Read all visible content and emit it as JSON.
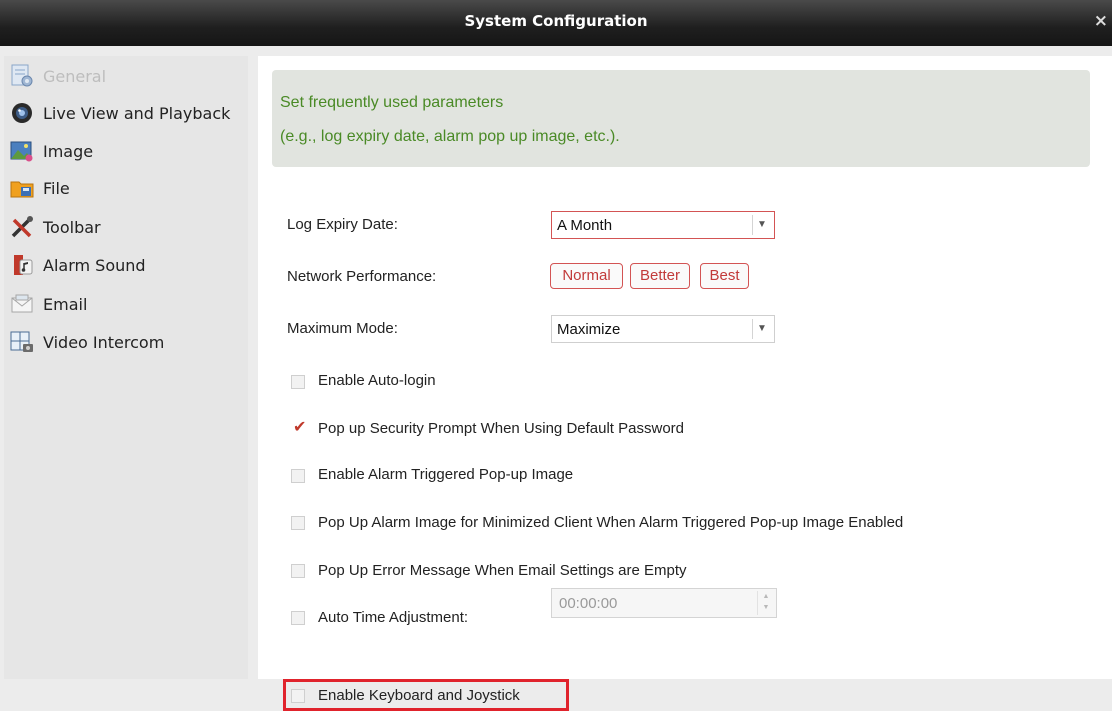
{
  "window": {
    "title": "System Configuration",
    "close_symbol": "×"
  },
  "sidebar": {
    "items": [
      {
        "label": "General",
        "icon": "general-settings-icon",
        "active": true
      },
      {
        "label": "Live View and Playback",
        "icon": "camera-lens-icon"
      },
      {
        "label": "Image",
        "icon": "image-icon"
      },
      {
        "label": "File",
        "icon": "file-folder-icon"
      },
      {
        "label": "Toolbar",
        "icon": "tools-icon"
      },
      {
        "label": "Alarm Sound",
        "icon": "alarm-sound-icon"
      },
      {
        "label": "Email",
        "icon": "email-icon"
      },
      {
        "label": "Video Intercom",
        "icon": "video-intercom-icon"
      }
    ]
  },
  "banner": {
    "line1": "Set frequently used parameters",
    "line2": "(e.g., log expiry date, alarm pop up image, etc.)."
  },
  "settings": {
    "log_expiry": {
      "label": "Log Expiry Date:",
      "value": "A Month"
    },
    "network_performance": {
      "label": "Network Performance:",
      "options": [
        "Normal",
        "Better",
        "Best"
      ]
    },
    "maximum_mode": {
      "label": "Maximum Mode:",
      "value": "Maximize"
    },
    "checkboxes": [
      {
        "label": "Enable Auto-login",
        "checked": false
      },
      {
        "label": "Pop up Security Prompt When Using Default Password",
        "checked": true
      },
      {
        "label": "Enable Alarm Triggered Pop-up Image",
        "checked": false
      },
      {
        "label": "Pop Up Alarm Image for Minimized Client When Alarm Triggered Pop-up Image Enabled",
        "checked": false
      },
      {
        "label": "Pop Up Error Message When Email Settings are Empty",
        "checked": false
      },
      {
        "label": "Auto Time Adjustment:",
        "checked": false
      },
      {
        "label": "Enable Keyboard and Joystick",
        "checked": false
      }
    ],
    "auto_time": {
      "value": "00:00:00"
    }
  },
  "colors": {
    "banner_text": "#4a8a26",
    "accent_red": "#d35454",
    "highlight": "#e0232c"
  }
}
